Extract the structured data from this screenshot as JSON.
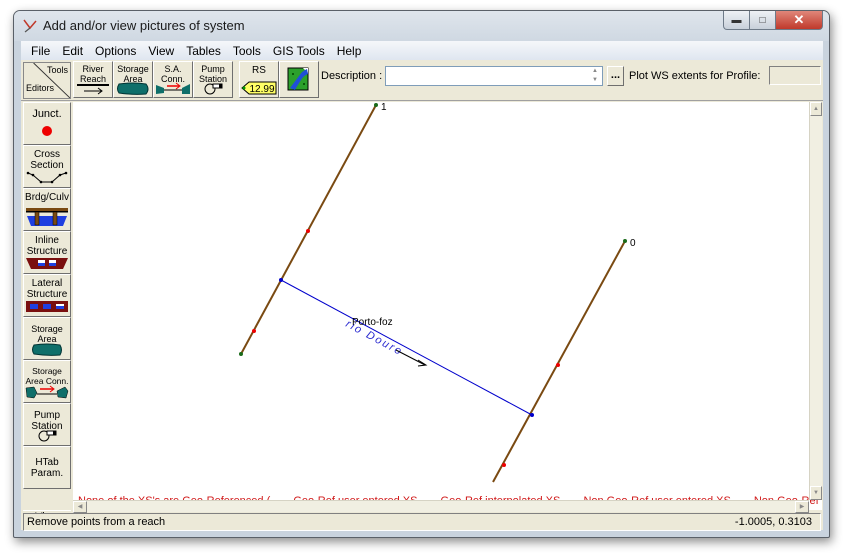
{
  "window": {
    "title": "Add and/or view pictures of system",
    "controls": {
      "minimize": "minimize",
      "maximize": "maximize",
      "close": "close"
    }
  },
  "menu": [
    "File",
    "Edit",
    "Options",
    "View",
    "Tables",
    "Tools",
    "GIS Tools",
    "Help"
  ],
  "toolbar": {
    "tools_label": "Tools",
    "editors_label": "Editors",
    "buttons": [
      {
        "label1": "River",
        "label2": "Reach",
        "icon": "river-reach-icon"
      },
      {
        "label1": "Storage",
        "label2": "Area",
        "icon": "storage-area-icon"
      },
      {
        "label1": "S.A.",
        "label2": "Conn.",
        "icon": "sa-connection-icon"
      },
      {
        "label1": "Pump",
        "label2": "Station",
        "icon": "pump-station-icon"
      },
      {
        "label1": "RS",
        "label2": "12.99",
        "icon": "river-station-tag-icon"
      },
      {
        "label1": "",
        "label2": "",
        "icon": "background-map-icon"
      }
    ],
    "description_label": "Description :",
    "description_value": "",
    "dots_label": "...",
    "ws_extents_label": "Plot WS extents for Profile:",
    "ws_extents_value": ""
  },
  "editors": [
    {
      "label1": "Junct.",
      "label2": "",
      "icon": "junction-icon"
    },
    {
      "label1": "Cross",
      "label2": "Section",
      "icon": "cross-section-icon"
    },
    {
      "label1": "Brdg/Culv",
      "label2": "",
      "icon": "bridge-culvert-icon"
    },
    {
      "label1": "Inline",
      "label2": "Structure",
      "icon": "inline-structure-icon"
    },
    {
      "label1": "Lateral",
      "label2": "Structure",
      "icon": "lateral-structure-icon"
    },
    {
      "label1": "Storage",
      "label2": "Area",
      "icon": "storage-area-icon"
    },
    {
      "label1": "Storage",
      "label2": "Area Conn.",
      "icon": "storage-area-conn-icon"
    },
    {
      "label1": "Pump",
      "label2": "Station",
      "icon": "pump-station-icon"
    },
    {
      "label1": "HTab",
      "label2": "Param.",
      "icon": ""
    }
  ],
  "view_tab": "View",
  "map": {
    "reach_name": "rio Douro",
    "reach_label": "Porto-foz",
    "cross_sections": [
      {
        "id": "1",
        "color": "#7a4a12"
      },
      {
        "id": "0",
        "color": "#7a4a12"
      }
    ],
    "reach_color": "#0000cc",
    "legend": {
      "prefix": "None of the XS's are Geo-Referenced (",
      "items": [
        {
          "label": "Geo-Ref user entered XS",
          "color": "#006400"
        },
        {
          "label": "Geo-Ref interpolated XS",
          "color": "#22cc22"
        },
        {
          "label": "Non Geo-Ref user entered XS",
          "color": "#6b3a10"
        },
        {
          "label": "Non Geo-Ref",
          "color": "#ff7f3f"
        }
      ],
      "text_color": "#d01818"
    }
  },
  "status": {
    "message": "Remove points from a reach",
    "coordinates": "-1.0005, 0.3103"
  }
}
